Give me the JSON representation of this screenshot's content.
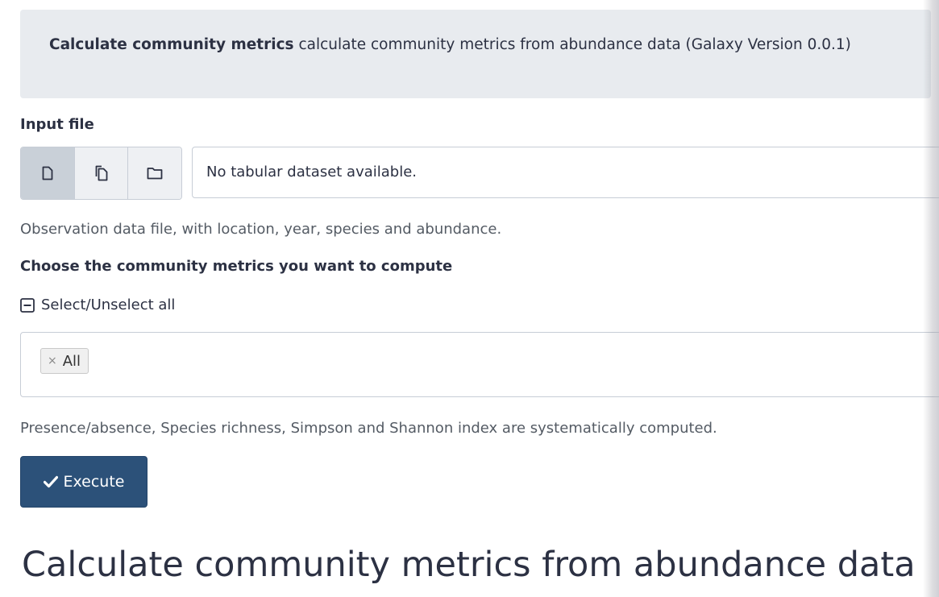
{
  "tool_header": {
    "name": "Calculate community metrics",
    "description": "calculate community metrics from abundance data (Galaxy Version 0.0.1)"
  },
  "input_file": {
    "label": "Input file",
    "source_buttons": [
      {
        "icon": "single-file-icon",
        "active": true
      },
      {
        "icon": "multiple-files-icon",
        "active": false
      },
      {
        "icon": "folder-icon",
        "active": false
      }
    ],
    "selected_value": "No tabular dataset available.",
    "help": "Observation data file, with location, year, species and abundance."
  },
  "metrics": {
    "label": "Choose the community metrics you want to compute",
    "select_all_label": "Select/Unselect all",
    "select_all_icon": "minus-square-icon",
    "selected_chips": [
      "All"
    ],
    "chip_remove_glyph": "×",
    "help": "Presence/absence, Species richness, Simpson and Shannon index are systematically computed."
  },
  "execute": {
    "label": "Execute",
    "icon": "check-icon",
    "color": "#2c5179"
  },
  "help_section": {
    "title": "Calculate community metrics from abundance data"
  },
  "colors": {
    "header_bg": "#e8ebef",
    "active_source_bg": "#c9d0d8",
    "primary": "#2c5179"
  }
}
